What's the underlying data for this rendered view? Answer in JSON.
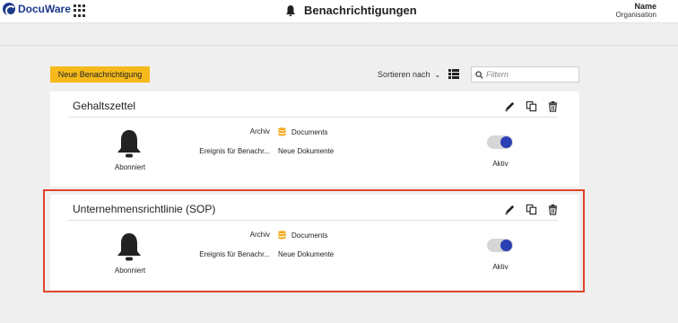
{
  "app": {
    "logo_text": "DocuWare",
    "brand_color": "#1b3a8c"
  },
  "header": {
    "title": "Benachrichtigungen",
    "icon": "bell-icon"
  },
  "user": {
    "name": "Name",
    "organisation": "Organisation"
  },
  "toolbar": {
    "new_button_label": "Neue Benachrichtigung",
    "new_button_color": "#f5b91a",
    "sort_label": "Sortieren nach",
    "filter_placeholder": "Filtern"
  },
  "cards": [
    {
      "title": "Gehaltszettel",
      "status_label": "Abonniert",
      "fields": [
        {
          "label": "Archiv",
          "value": "Documents",
          "icon": "database-icon"
        },
        {
          "label": "Ereignis für Benachr...",
          "value": "Neue Dokumente"
        }
      ],
      "toggle_on": true,
      "toggle_label": "Aktiv"
    },
    {
      "title": "Unternehmensrichtlinie (SOP)",
      "status_label": "Abonniert",
      "fields": [
        {
          "label": "Archiv",
          "value": "Documents",
          "icon": "database-icon"
        },
        {
          "label": "Ereignis für Benachr...",
          "value": "Neue Dokumente"
        }
      ],
      "toggle_on": true,
      "toggle_label": "Aktiv",
      "highlighted": true
    }
  ],
  "colors": {
    "highlight": "#e0452b",
    "toggle_knob": "#2b3fb5",
    "db_icon": "#f0a91c"
  }
}
